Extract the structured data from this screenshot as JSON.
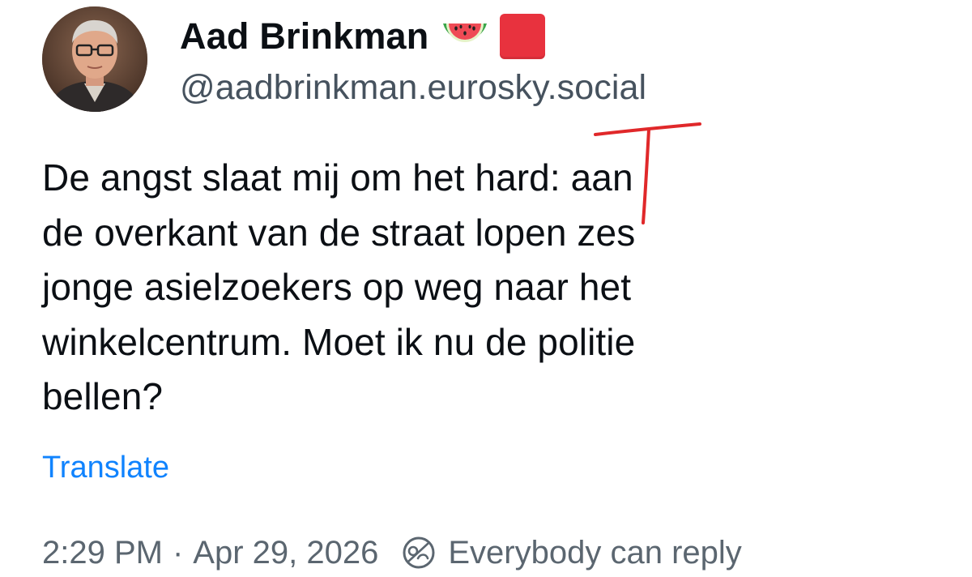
{
  "author": {
    "display_name": "Aad Brinkman",
    "name_emojis": [
      "watermelon-icon",
      "red-square-icon"
    ],
    "handle": "@aadbrinkman.eurosky.social"
  },
  "post": {
    "lines": [
      "De angst slaat mij om het hard: aan",
      "de overkant van de straat lopen zes",
      "jonge asielzoekers op weg naar het",
      "winkelcentrum. Moet ik nu de politie",
      "bellen?"
    ]
  },
  "actions": {
    "translate_label": "Translate"
  },
  "meta": {
    "time": "2:29 PM",
    "separator": "·",
    "date": "Apr 29, 2026",
    "reply_setting": "Everybody can reply"
  },
  "colors": {
    "link": "#1083fe",
    "muted": "#5b6670",
    "annotation": "#e0282a",
    "red_square": "#e8323e"
  }
}
